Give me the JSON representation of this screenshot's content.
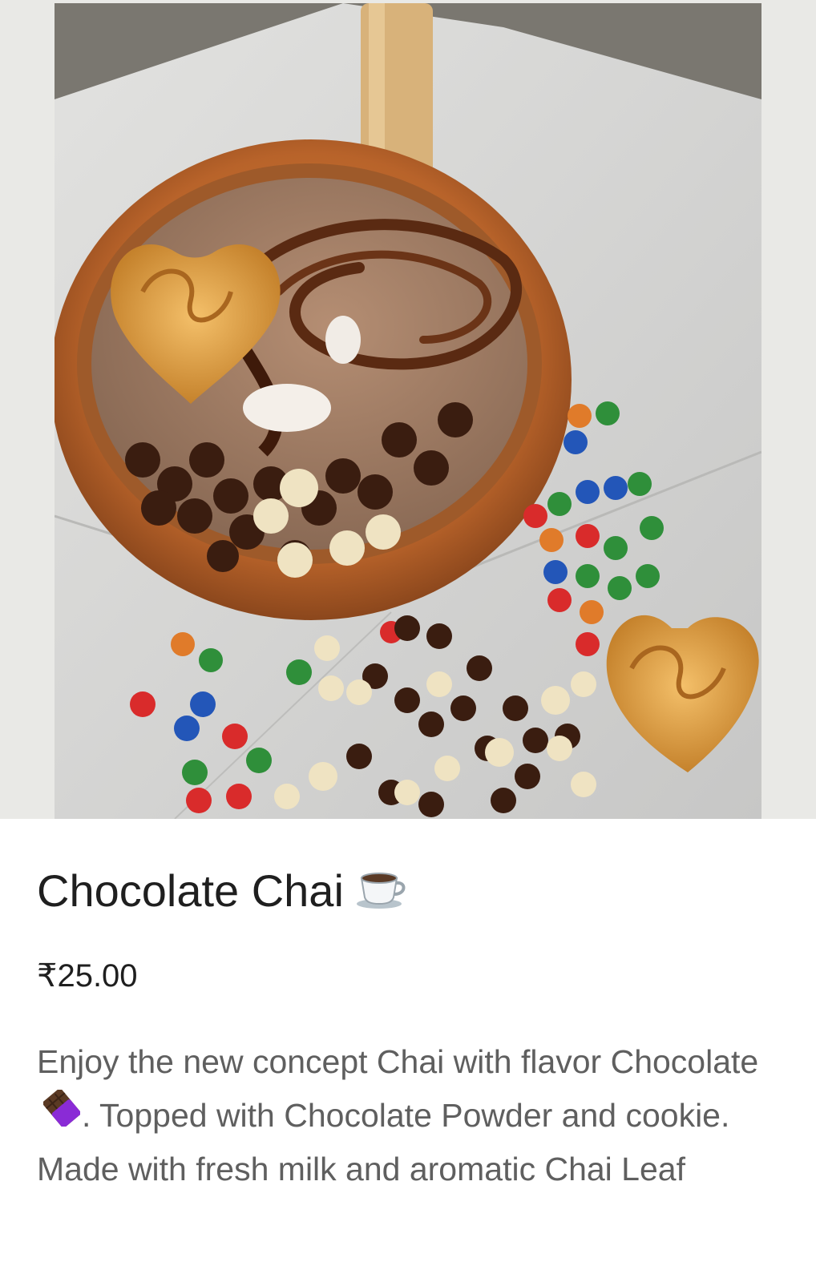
{
  "product": {
    "image_alt": "Chocolate Chai in a clay cup topped with chocolate chips and a heart cookie",
    "title": "Chocolate Chai",
    "title_icon": "coffee-cup-icon",
    "price": "₹25.00",
    "description_part1": "Enjoy the new concept Chai with flavor Chocolate",
    "description_icon": "chocolate-bar-icon",
    "description_part2": ". Topped with Chocolate Powder and cookie. Made with fresh milk and aromatic Chai Leaf"
  },
  "colors": {
    "title_text": "#1f1f1f",
    "description_text": "#5f5f5f",
    "background": "#ffffff"
  }
}
